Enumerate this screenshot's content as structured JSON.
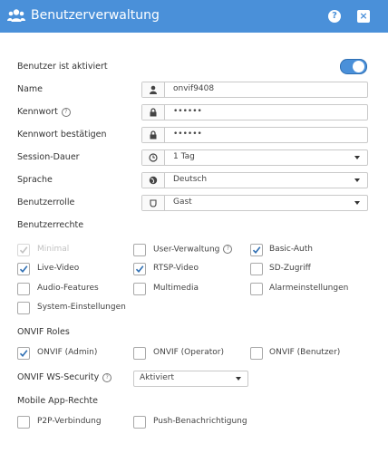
{
  "window": {
    "title": "Benutzerverwaltung",
    "help_label": "?",
    "close_label": "×"
  },
  "form": {
    "active_label": "Benutzer ist aktiviert",
    "active_on": true,
    "name_label": "Name",
    "name_value": "onvif9408",
    "password_label": "Kennwort",
    "password_value": "••••••",
    "password_confirm_label": "Kennwort bestätigen",
    "password_confirm_value": "••••••",
    "session_label": "Session-Dauer",
    "session_value": "1 Tag",
    "language_label": "Sprache",
    "language_value": "Deutsch",
    "role_label": "Benutzerrolle",
    "role_value": "Gast"
  },
  "rights": {
    "heading": "Benutzerrechte",
    "items": [
      {
        "label": "Minimal",
        "checked": true,
        "disabled": true
      },
      {
        "label": "User-Verwaltung",
        "checked": false,
        "disabled": false
      },
      {
        "label": "Basic-Auth",
        "checked": true,
        "disabled": false
      },
      {
        "label": "Live-Video",
        "checked": true,
        "disabled": false
      },
      {
        "label": "RTSP-Video",
        "checked": true,
        "disabled": false
      },
      {
        "label": "SD-Zugriff",
        "checked": false,
        "disabled": false
      },
      {
        "label": "Audio-Features",
        "checked": false,
        "disabled": false
      },
      {
        "label": "Multimedia",
        "checked": false,
        "disabled": false
      },
      {
        "label": "Alarmeinstellungen",
        "checked": false,
        "disabled": false
      },
      {
        "label": "System-Einstellungen",
        "checked": false,
        "disabled": false
      }
    ]
  },
  "onvif": {
    "heading": "ONVIF Roles",
    "items": [
      {
        "label": "ONVIF (Admin)",
        "checked": true
      },
      {
        "label": "ONVIF (Operator)",
        "checked": false
      },
      {
        "label": "ONVIF (Benutzer)",
        "checked": false
      }
    ],
    "security_label": "ONVIF WS-Security",
    "security_value": "Aktiviert"
  },
  "mobile": {
    "heading": "Mobile App-Rechte",
    "items": [
      {
        "label": "P2P-Verbindung",
        "checked": false
      },
      {
        "label": "Push-Benachrichtigung",
        "checked": false
      }
    ]
  },
  "colors": {
    "accent": "#4a90d9",
    "check": "#2f6fb3",
    "disabled": "#c2c2c2"
  },
  "icons": [
    "users-icon",
    "help-icon",
    "close-icon",
    "user-icon",
    "lock-icon",
    "clock-icon",
    "globe-icon",
    "role-icon",
    "chevron-down-icon",
    "question-icon",
    "checkmark-icon"
  ]
}
